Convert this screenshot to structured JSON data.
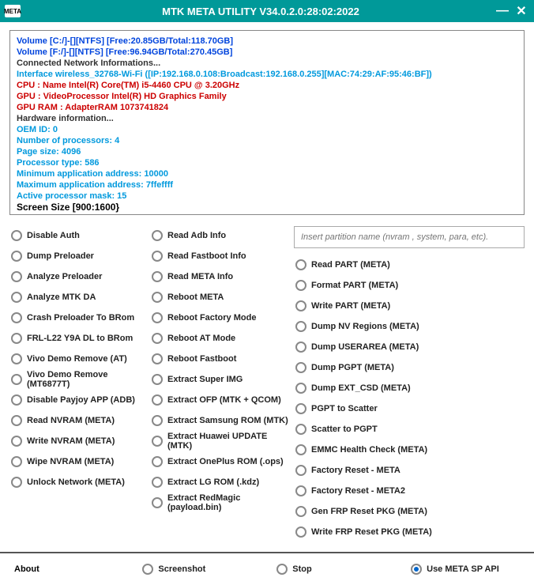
{
  "titlebar": {
    "title": "MTK META UTILITY V34.0.2.0:28:02:2022",
    "icon_label": "META"
  },
  "log": {
    "lines": [
      {
        "cls": "blue",
        "text": "Volume [C:/]-[][NTFS] [Free:20.85GB/Total:118.70GB]"
      },
      {
        "cls": "blue",
        "text": "Volume [F:/]-[][NTFS] [Free:96.94GB/Total:270.45GB]"
      },
      {
        "cls": "grey",
        "text": "Connected Network Informations..."
      },
      {
        "cls": "bright",
        "text": "Interface wireless_32768-Wi-Fi ([IP:192.168.0.108:Broadcast:192.168.0.255][MAC:74:29:AF:95:46:BF])"
      },
      {
        "cls": "red",
        "text": "CPU  : Name Intel(R) Core(TM) i5-4460 CPU @ 3.20GHz"
      },
      {
        "cls": "red",
        "text": "GPU  : VideoProcessor Intel(R) HD Graphics Family"
      },
      {
        "cls": "red",
        "text": "GPU RAM  : AdapterRAM 1073741824"
      },
      {
        "cls": "grey",
        "text": "Hardware information..."
      },
      {
        "cls": "bright",
        "text": "OEM ID: 0"
      },
      {
        "cls": "bright",
        "text": "Number of processors: 4"
      },
      {
        "cls": "bright",
        "text": "Page size: 4096"
      },
      {
        "cls": "bright",
        "text": "Processor type: 586"
      },
      {
        "cls": "bright",
        "text": "Minimum application address: 10000"
      },
      {
        "cls": "bright",
        "text": "Maximum application address: 7ffeffff"
      },
      {
        "cls": "bright",
        "text": "Active processor mask: 15"
      },
      {
        "cls": "black",
        "text": "Screen Size [900:1600}"
      }
    ]
  },
  "col1": [
    "Disable Auth",
    "Dump Preloader",
    "Analyze Preloader",
    "Analyze MTK DA",
    "Crash Preloader To BRom",
    "FRL-L22 Y9A DL to BRom",
    "Vivo Demo Remove (AT)",
    "Vivo Demo Remove (MT6877T)",
    "Disable Payjoy APP (ADB)",
    "Read NVRAM (META)",
    "Write NVRAM (META)",
    "Wipe NVRAM (META)",
    "Unlock Network (META)"
  ],
  "col2": [
    "Read Adb Info",
    "Read Fastboot Info",
    "Read META Info",
    "Reboot META",
    "Reboot Factory Mode",
    "Reboot AT Mode",
    "Reboot Fastboot",
    "Extract Super IMG",
    "Extract OFP (MTK + QCOM)",
    "Extract Samsung ROM (MTK)",
    "Extract Huawei UPDATE (MTK)",
    "Extract OnePlus ROM (.ops)",
    "Extract LG ROM (.kdz)",
    "Extract RedMagic (payload.bin)"
  ],
  "col3_input_placeholder": "Insert partition name (nvram , system, para, etc).",
  "col3": [
    "Read PART (META)",
    "Format PART (META)",
    "Write PART (META)",
    "Dump NV Regions (META)",
    "Dump USERAREA (META)",
    "Dump PGPT (META)",
    "Dump  EXT_CSD (META)",
    "PGPT to Scatter",
    "Scatter to PGPT",
    "EMMC Health Check (META)",
    "Factory Reset - META",
    "Factory Reset - META2",
    "Gen FRP Reset PKG (META)",
    "Write FRP Reset PKG (META)"
  ],
  "footer": {
    "about": "About",
    "screenshot": "Screenshot",
    "stop": "Stop",
    "use_meta": "Use META SP API"
  }
}
